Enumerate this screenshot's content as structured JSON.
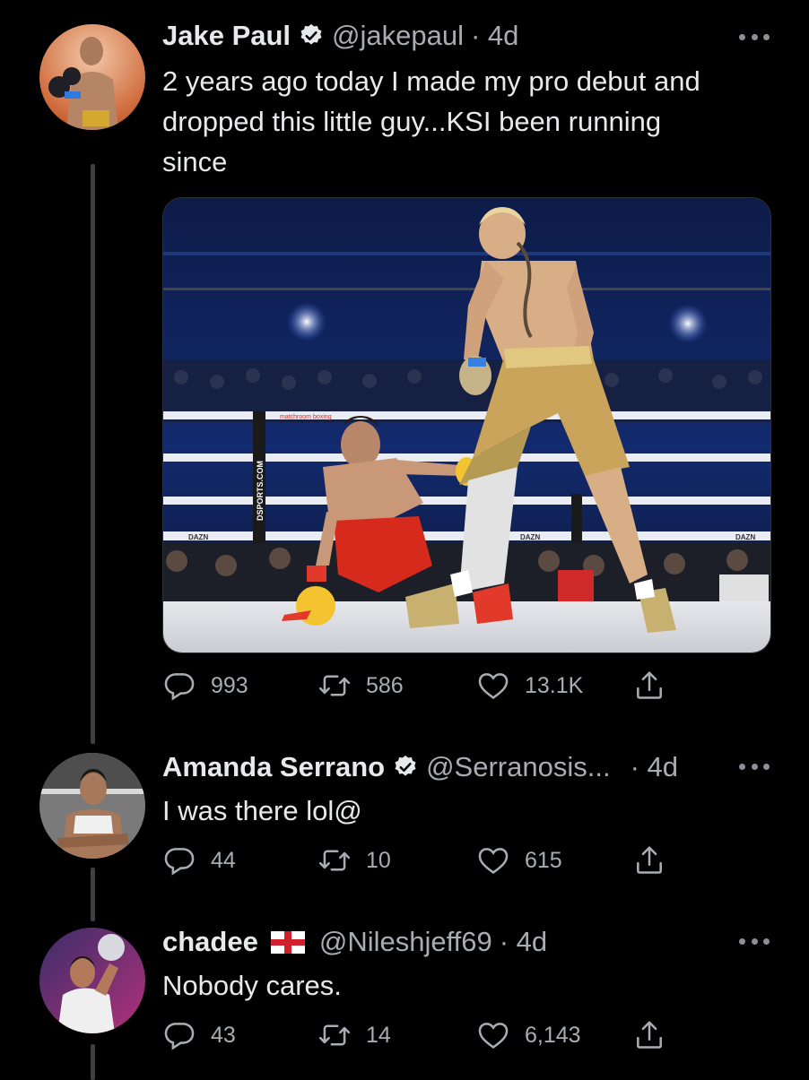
{
  "tweets": [
    {
      "name": "Jake Paul",
      "handle": "@jakepaul",
      "time": "· 4d",
      "text_lines": [
        "2 years ago today I made my pro debut and",
        "dropped this little guy...KSI been running",
        "since"
      ],
      "media": {
        "banner_left": "matchroom boxing",
        "banner_right": "DAZN",
        "post_text": "DSPORTS.COM"
      },
      "stats": {
        "replies": "993",
        "retweets": "586",
        "likes": "13.1K"
      }
    },
    {
      "name": "Amanda Serrano",
      "handle": "@Serranosis...",
      "time": "· 4d",
      "text": "I was there lol@",
      "stats": {
        "replies": "44",
        "retweets": "10",
        "likes": "615"
      }
    },
    {
      "name": "chadee",
      "handle": "@Nileshjeff69",
      "time": "· 4d",
      "text": "Nobody cares.",
      "stats": {
        "replies": "43",
        "retweets": "14",
        "likes": "6,143"
      }
    }
  ],
  "icons": [
    "reply-icon",
    "retweet-icon",
    "like-icon",
    "share-icon",
    "verified-icon",
    "england-flag-icon",
    "more-icon"
  ],
  "colors": {
    "background": "#000000",
    "text": "#e7e9ea",
    "secondary": "#a7adb2",
    "thread_line": "#3e4144"
  }
}
